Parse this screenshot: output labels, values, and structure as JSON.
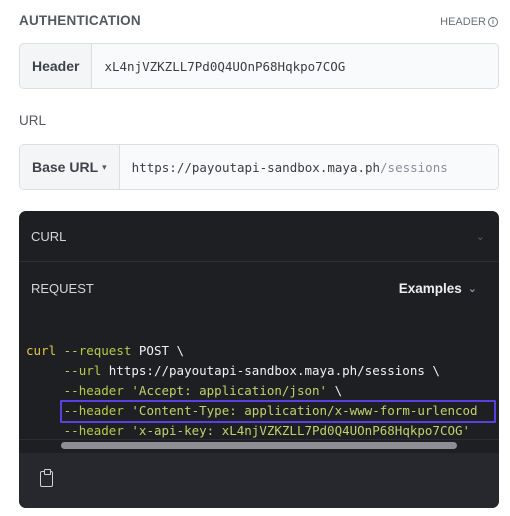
{
  "authentication": {
    "title": "AUTHENTICATION",
    "type_label": "HEADER",
    "info_glyph": "i",
    "header_label": "Header",
    "header_value": "xL4njVZKZLL7Pd0Q4UOnP68Hqkpo7COG"
  },
  "url": {
    "title": "URL",
    "base_label": "Base URL",
    "base_chevron": "▾",
    "base_value": "https://payoutapi-sandbox.maya.ph",
    "path_value": "/sessions"
  },
  "panel": {
    "curl_label": "CURL",
    "request_label": "REQUEST",
    "examples_label": "Examples",
    "chevron": "⌄"
  },
  "code": {
    "line1_cmd": "curl",
    "line1_flag": "--request",
    "line1_rest": " POST \\",
    "line2_flag": "--url",
    "line2_rest": " https://payoutapi-sandbox.maya.ph/sessions \\",
    "line3_flag": "--header",
    "line3_str": "'Accept: application/json'",
    "line3_tail": " \\",
    "line4_flag": "--header",
    "line4_str": "'Content-Type: application/x-www-form-urlencod",
    "line5_flag": "--header",
    "line5_str": "'x-api-key: xL4njVZKZLL7Pd0Q4UOnP68Hqkpo7COG'"
  },
  "colors": {
    "highlight": "#5b3fe0",
    "panel_bg": "#1d1f23"
  },
  "icons": {
    "copy": "clipboard-icon",
    "info": "info-icon",
    "chevron": "chevron-down-icon"
  }
}
